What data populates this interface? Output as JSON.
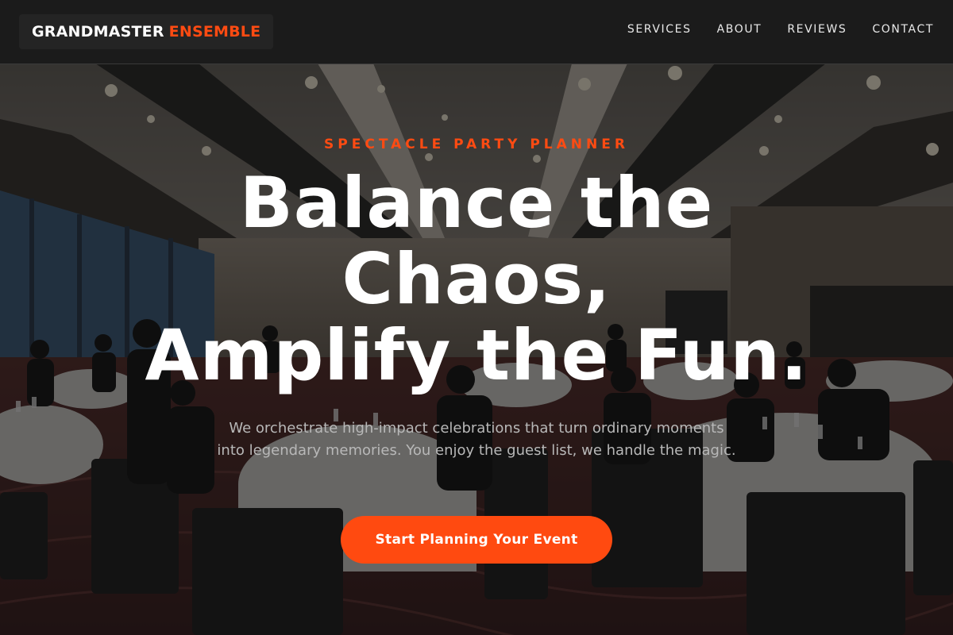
{
  "header": {
    "logo_main": "GRANDMASTER",
    "logo_accent": "ENSEMBLE",
    "nav": [
      {
        "label": "SERVICES"
      },
      {
        "label": "ABOUT"
      },
      {
        "label": "REVIEWS"
      },
      {
        "label": "CONTACT"
      }
    ]
  },
  "hero": {
    "eyebrow": "SPECTACLE PARTY PLANNER",
    "headline_lines": [
      "Balance the",
      "Chaos,",
      "Amplify the Fun."
    ],
    "subtitle": "We orchestrate high-impact celebrations that turn ordinary moments into legendary memories. You enjoy the guest list, we handle the magic.",
    "cta_label": "Start Planning Your Event"
  },
  "colors": {
    "accent": "#ff4a10",
    "header_bg": "#1b1b1b",
    "text_primary": "#ffffff",
    "text_muted": "#b8b8b8"
  }
}
